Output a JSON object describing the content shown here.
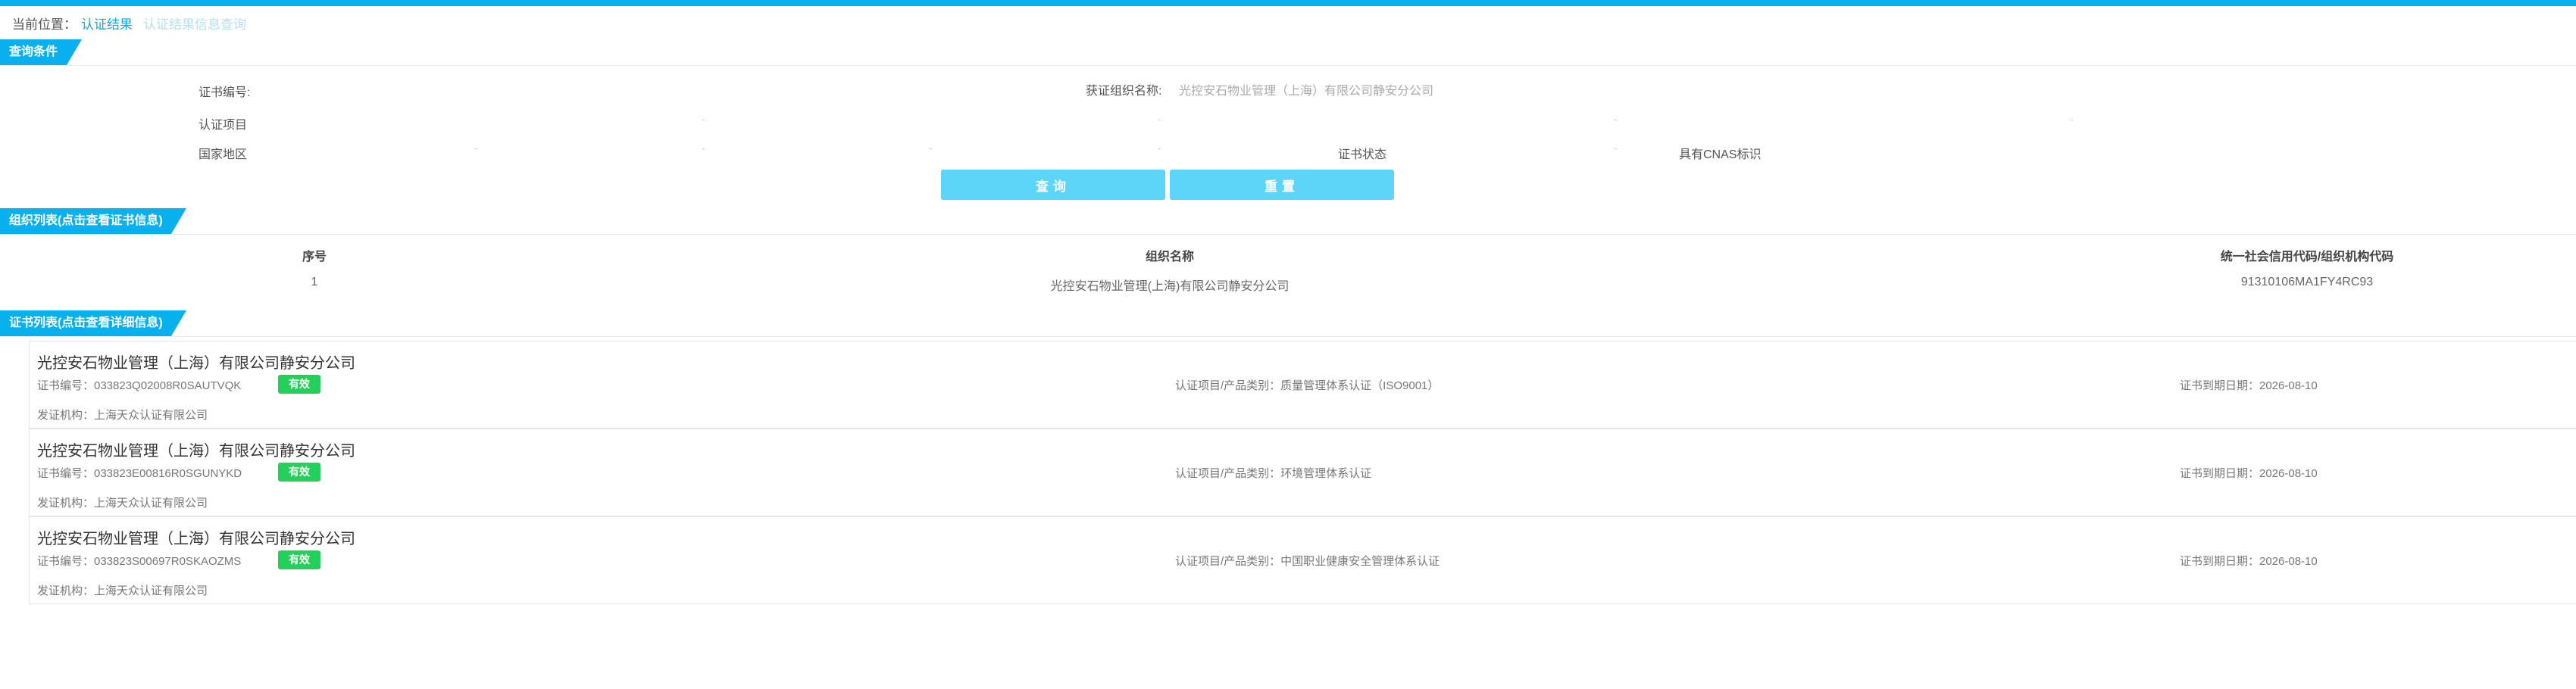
{
  "breadcrumb": {
    "prefix": "当前位置：",
    "link": "认证结果",
    "current": "认证结果信息查询"
  },
  "query": {
    "section_title": "查询条件",
    "cert_no_label": "证书编号:",
    "org_name_label": "获证组织名称:",
    "org_name_value": "光控安石物业管理（上海）有限公司静安分公司",
    "project_label": "认证项目",
    "region_label": "国家地区",
    "status_label": "证书状态",
    "cnas_label": "具有CNAS标识",
    "search_button": "查询",
    "reset_button": "重置"
  },
  "org_list": {
    "section_title": "组织列表(点击查看证书信息)",
    "headers": [
      "序号",
      "组织名称",
      "统一社会信用代码/组织机构代码"
    ],
    "rows": [
      [
        "1",
        "光控安石物业管理(上海)有限公司静安分公司",
        "91310106MA1FY4RC93"
      ]
    ]
  },
  "cert_list": {
    "section_title": "证书列表(点击查看详细信息)",
    "items": [
      {
        "org": "光控安石物业管理（上海）有限公司静安分公司",
        "cert_no": "证书编号：033823Q02008R0SAUTVQK",
        "status": "有效",
        "category": "认证项目/产品类别：质量管理体系认证（ISO9001）",
        "expiry": "证书到期日期：2026-08-10",
        "issuer": "发证机构：上海天众认证有限公司"
      },
      {
        "org": "光控安石物业管理（上海）有限公司静安分公司",
        "cert_no": "证书编号：033823E00816R0SGUNYKD",
        "status": "有效",
        "category": "认证项目/产品类别：环境管理体系认证",
        "expiry": "证书到期日期：2026-08-10",
        "issuer": "发证机构：上海天众认证有限公司"
      },
      {
        "org": "光控安石物业管理（上海）有限公司静安分公司",
        "cert_no": "证书编号：033823S00697R0SKAOZMS",
        "status": "有效",
        "category": "认证项目/产品类别：中国职业健康安全管理体系认证",
        "expiry": "证书到期日期：2026-08-10",
        "issuer": "发证机构：上海天众认证有限公司"
      }
    ]
  },
  "colors": {
    "accent": "#09b0ee",
    "button": "#5dd5f8",
    "valid_badge": "#22d05a"
  }
}
